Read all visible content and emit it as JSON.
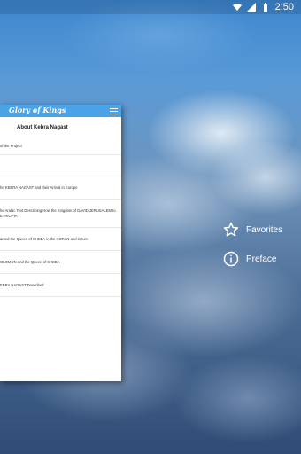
{
  "status": {
    "time": "2:50"
  },
  "drawer": {
    "title": "Glory of Kings",
    "section_title": "About Kebra Nagast",
    "chapters": [
      {
        "text": "of the Project"
      },
      {
        "text": ""
      },
      {
        "text": "he KEBRA NAGAST and their Arrival in Europe"
      },
      {
        "text": "he Arabic Text Describing How the Kingdom of DAVID JERUSALEM to ETHIOPIA"
      },
      {
        "text": "amed the Queen of SHEBA in the KORAN and in ture"
      },
      {
        "text": "OLOMON and the Queen of SHEBA"
      },
      {
        "text": "EBRA NAGAST Described"
      }
    ]
  },
  "side_menu": {
    "favorites": "Favorites",
    "preface": "Preface"
  },
  "icons": {
    "menu": "hamburger-menu-icon",
    "star": "star-outline-icon",
    "info": "info-icon"
  }
}
